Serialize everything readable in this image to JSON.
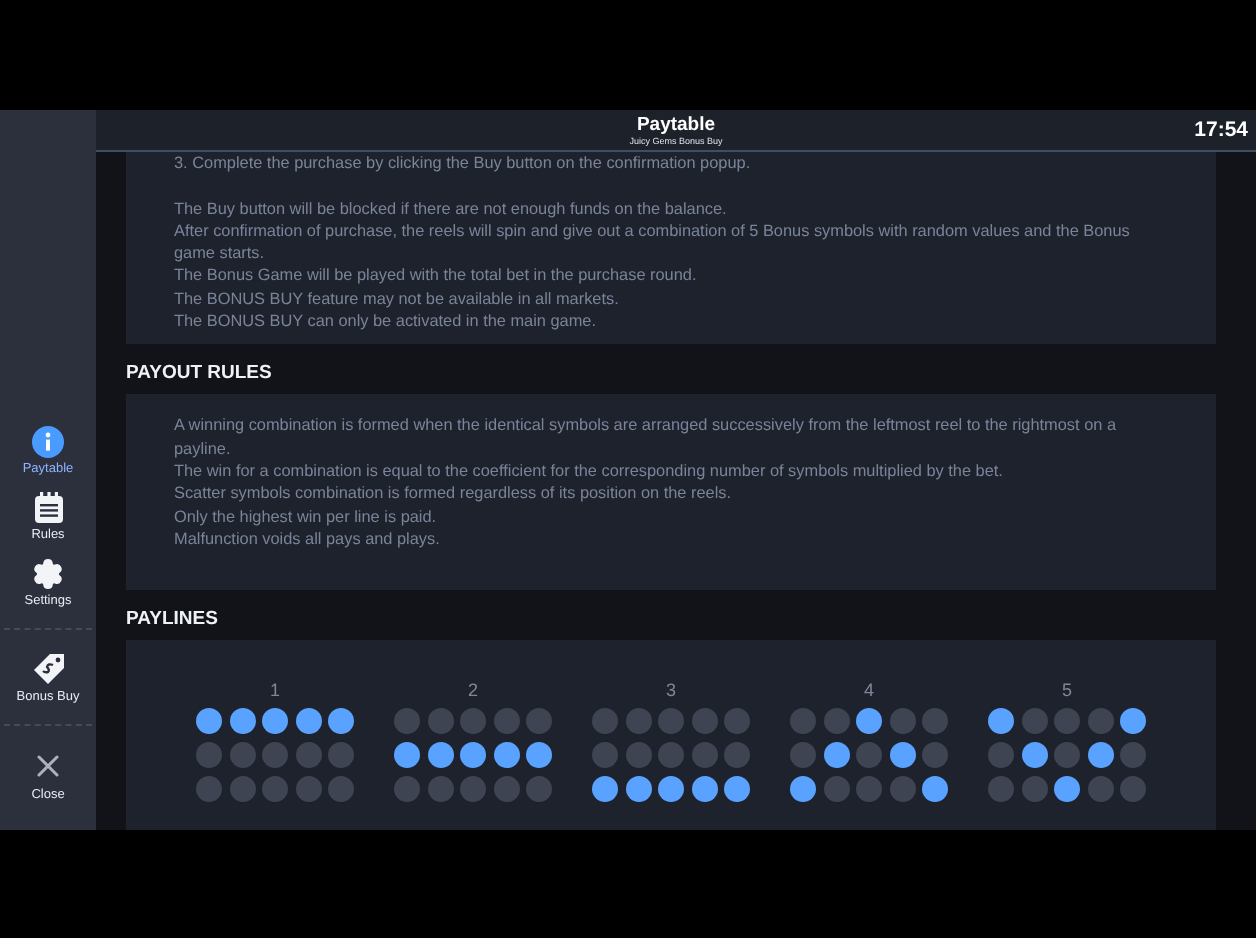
{
  "header": {
    "title": "Paytable",
    "subtitle": "Juicy Gems Bonus Buy",
    "time": "17:54"
  },
  "sidebar": {
    "items": [
      {
        "kind": "info",
        "label": "Paytable",
        "selected": true
      },
      {
        "kind": "rules",
        "label": "Rules",
        "selected": false
      },
      {
        "kind": "settings",
        "label": "Settings",
        "selected": false
      },
      {
        "kind": "bonus",
        "label": "Bonus Buy",
        "selected": false
      },
      {
        "kind": "close",
        "label": "Close",
        "selected": false
      }
    ]
  },
  "bonus_buy_text": {
    "steps": [
      "3. Complete the purchase by clicking the Buy button on the confirmation popup."
    ],
    "notes": [
      "The Buy button will be blocked if there are not enough funds on the balance.",
      "After confirmation of purchase, the reels will spin and give out a combination of 5 Bonus symbols with random values and the Bonus game starts.",
      "The Bonus Game will be played with the total bet in the purchase round.",
      "The BONUS BUY feature may not be available in all markets.",
      "The BONUS BUY can only be activated in the main game."
    ]
  },
  "payout_rules": {
    "title": "PAYOUT RULES",
    "lines": [
      "A winning combination is formed when the identical symbols are arranged successively from the leftmost reel to the rightmost on a payline.",
      "The win for a combination is equal to the coefficient for the corresponding number of symbols multiplied by the bet.",
      "Scatter symbols combination is formed regardless of its position on the reels.",
      "Only the highest win per line is paid.",
      "Malfunction voids all pays and plays."
    ]
  },
  "paylines": {
    "title": "PAYLINES",
    "items": [
      {
        "number": "1",
        "rows": [
          [
            true,
            true,
            true,
            true,
            true
          ],
          [
            false,
            false,
            false,
            false,
            false
          ],
          [
            false,
            false,
            false,
            false,
            false
          ]
        ]
      },
      {
        "number": "2",
        "rows": [
          [
            false,
            false,
            false,
            false,
            false
          ],
          [
            true,
            true,
            true,
            true,
            true
          ],
          [
            false,
            false,
            false,
            false,
            false
          ]
        ]
      },
      {
        "number": "3",
        "rows": [
          [
            false,
            false,
            false,
            false,
            false
          ],
          [
            false,
            false,
            false,
            false,
            false
          ],
          [
            true,
            true,
            true,
            true,
            true
          ]
        ]
      },
      {
        "number": "4",
        "rows": [
          [
            false,
            false,
            true,
            false,
            false
          ],
          [
            false,
            true,
            false,
            true,
            false
          ],
          [
            true,
            false,
            false,
            false,
            true
          ]
        ]
      },
      {
        "number": "5",
        "rows": [
          [
            true,
            false,
            false,
            false,
            true
          ],
          [
            false,
            true,
            false,
            true,
            false
          ],
          [
            false,
            false,
            true,
            false,
            false
          ]
        ]
      }
    ]
  }
}
